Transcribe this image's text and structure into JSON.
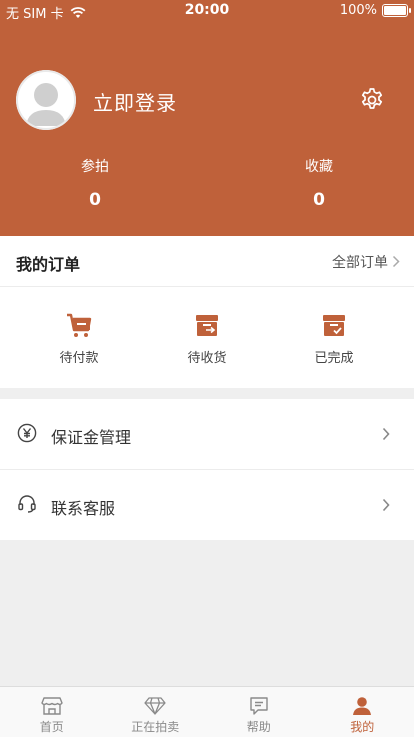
{
  "status_bar": {
    "carrier": "无 SIM 卡",
    "time": "20:00",
    "battery": "100%"
  },
  "header": {
    "login": "立即登录"
  },
  "stats": [
    {
      "label": "参拍",
      "value": "0"
    },
    {
      "label": "收藏",
      "value": "0"
    }
  ],
  "orders": {
    "title": "我的订单",
    "all": "全部订单",
    "items": [
      {
        "label": "待付款",
        "icon": "cart-icon"
      },
      {
        "label": "待收货",
        "icon": "box-receive-icon"
      },
      {
        "label": "已完成",
        "icon": "box-done-icon"
      }
    ]
  },
  "menu": [
    {
      "label": "保证金管理",
      "icon": "yen-icon"
    },
    {
      "label": "联系客服",
      "icon": "headset-icon"
    }
  ],
  "tabs": [
    {
      "label": "首页",
      "icon": "store-icon"
    },
    {
      "label": "正在拍卖",
      "icon": "diamond-icon"
    },
    {
      "label": "帮助",
      "icon": "message-icon"
    },
    {
      "label": "我的",
      "icon": "user-icon"
    }
  ],
  "colors": {
    "accent": "#bf613a",
    "background": "#efefef"
  }
}
